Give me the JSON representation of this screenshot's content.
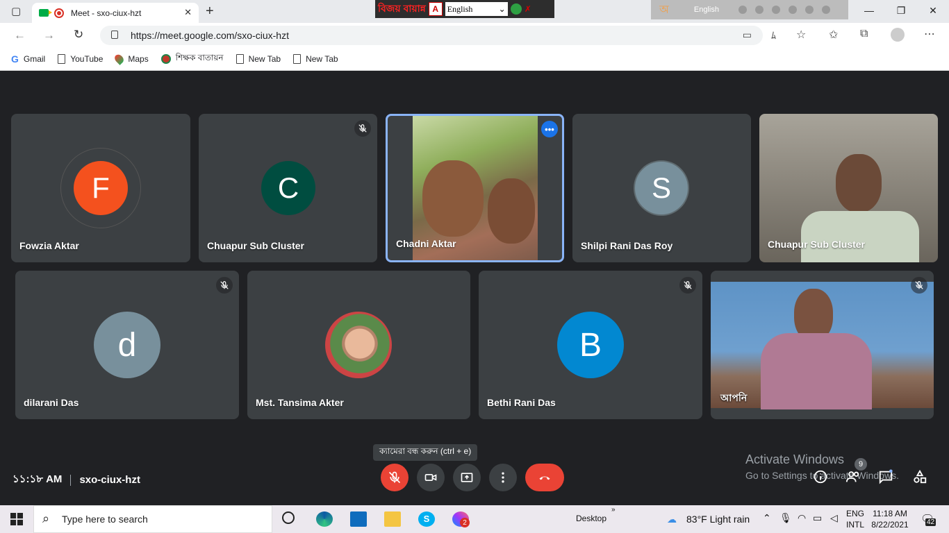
{
  "browser": {
    "tab_title": "Meet - sxo-ciux-hzt",
    "tab_close": "✕",
    "new_tab": "+",
    "url": "https://meet.google.com/sxo-ciux-hzt",
    "bookmarks": [
      "Gmail",
      "YouTube",
      "Maps",
      "শিক্ষক বাতায়ন",
      "New Tab",
      "New Tab"
    ]
  },
  "bijoy_toolbar": {
    "logo_text": "বিজয়",
    "brand_text": "বায়ান্ন",
    "adobe": "A",
    "language_select": "English"
  },
  "language_bar": {
    "bn_glyph": "অ",
    "language": "English"
  },
  "window_controls": {
    "minimize": "—",
    "maximize": "❐",
    "close": "✕"
  },
  "participants_row1": [
    {
      "name": "Fowzia Aktar",
      "initial": "F",
      "color": "#f4511e",
      "muted": false
    },
    {
      "name": "Chuapur Sub Cluster",
      "initial": "C",
      "color": "#004d40",
      "muted": true
    },
    {
      "name": "Chadni Aktar",
      "video": true,
      "muted": false,
      "active_speaker": true
    },
    {
      "name": "Shilpi Rani Das Roy",
      "initial": "S",
      "color": "#78909c",
      "muted": false
    },
    {
      "name": "Chuapur Sub Cluster",
      "video": true,
      "muted": false
    }
  ],
  "participants_row2": [
    {
      "name": "dilarani Das",
      "initial": "d",
      "color": "#78909c",
      "muted": true
    },
    {
      "name": "Mst. Tansima Akter",
      "photo": true,
      "muted": false
    },
    {
      "name": "Bethi Rani Das",
      "initial": "B",
      "color": "#0288d1",
      "muted": true
    },
    {
      "name": "আপনি",
      "video": true,
      "muted": true
    }
  ],
  "tooltip": "ক্যামেরা বন্ধ করুন (ctrl + e)",
  "meeting": {
    "time": "১১:১৮ AM",
    "code": "sxo-ciux-hzt",
    "people_count": "9"
  },
  "activation": {
    "line1": "Activate Windows",
    "line2": "Go to Settings to activate Windows."
  },
  "taskbar": {
    "search_placeholder": "Type here to search",
    "desktop_label": "Desktop",
    "weather": "83°F  Light rain",
    "lang_top": "ENG",
    "lang_bottom": "INTL",
    "time": "11:18 AM",
    "date": "8/22/2021",
    "notifications": "42",
    "messenger_badge": "2"
  }
}
